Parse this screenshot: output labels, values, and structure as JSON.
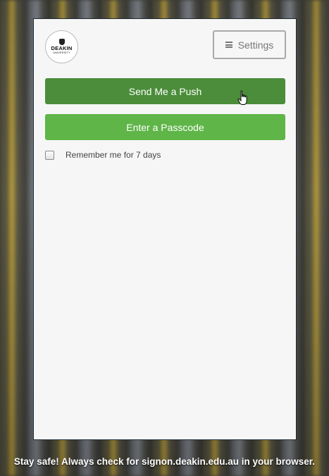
{
  "logo": {
    "name": "DEAKIN",
    "subtitle": "UNIVERSITY"
  },
  "settings": {
    "label": "Settings",
    "icon": "hamburger-menu-icon"
  },
  "actions": {
    "push_label": "Send Me a Push",
    "passcode_label": "Enter a Passcode"
  },
  "remember": {
    "label": "Remember me for 7 days",
    "checked": false
  },
  "footer": {
    "message": "Stay safe! Always check for signon.deakin.edu.au in your browser."
  },
  "colors": {
    "push_button": "#4b8d3a",
    "passcode_button": "#5fb548",
    "card_background": "#f6f6f6"
  }
}
